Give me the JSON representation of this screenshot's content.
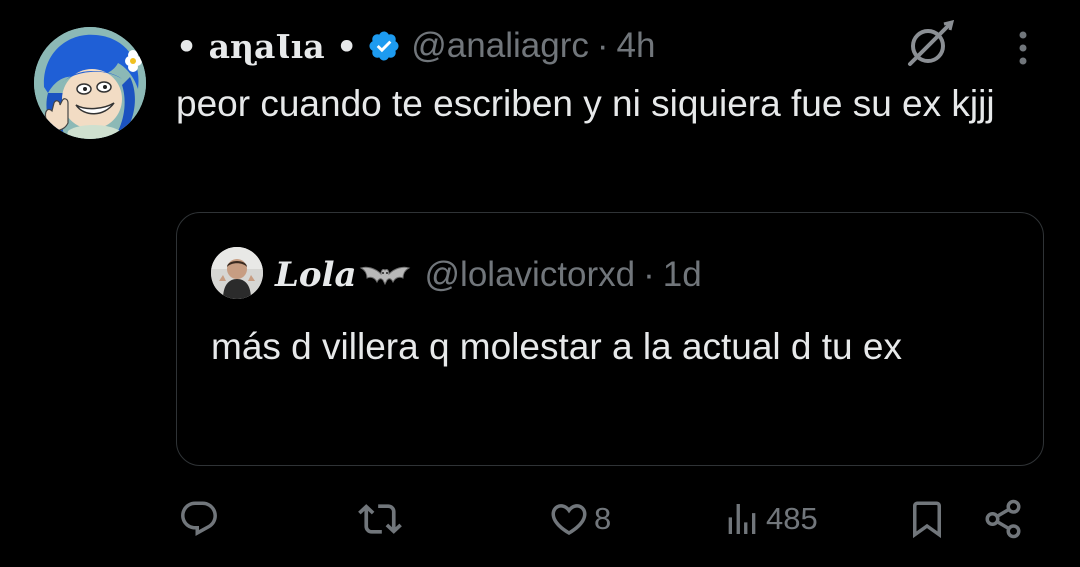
{
  "tweet": {
    "author": {
      "display_name": "• aɳaƖıa •",
      "handle": "@analiagrc",
      "verified": true,
      "avatar_icon": "cartoon-blue-hair-avatar"
    },
    "separator": "·",
    "timestamp": "4h",
    "text": "peor cuando te escriben y ni siquiera fue su ex kjjj",
    "header_icons": [
      "grok-icon",
      "more-options-icon"
    ]
  },
  "quote": {
    "author": {
      "display_name": "Lola",
      "handle": "@lolavictorxd",
      "name_emoji": "bat-icon",
      "avatar_icon": "person-photo-avatar"
    },
    "separator": "·",
    "timestamp": "1d",
    "text": "más d villera q molestar a la actual d tu ex"
  },
  "actions": {
    "reply": {
      "icon": "reply-icon",
      "count": ""
    },
    "repost": {
      "icon": "repost-icon",
      "count": ""
    },
    "like": {
      "icon": "heart-icon",
      "count": "8"
    },
    "views": {
      "icon": "views-icon",
      "count": "485"
    },
    "bookmark": {
      "icon": "bookmark-icon"
    },
    "share": {
      "icon": "share-icon"
    }
  },
  "colors": {
    "background": "#000000",
    "primary_text": "#e7e9ea",
    "secondary_text": "#71767b",
    "border": "#2f3336",
    "verified_blue": "#1d9bf0"
  }
}
